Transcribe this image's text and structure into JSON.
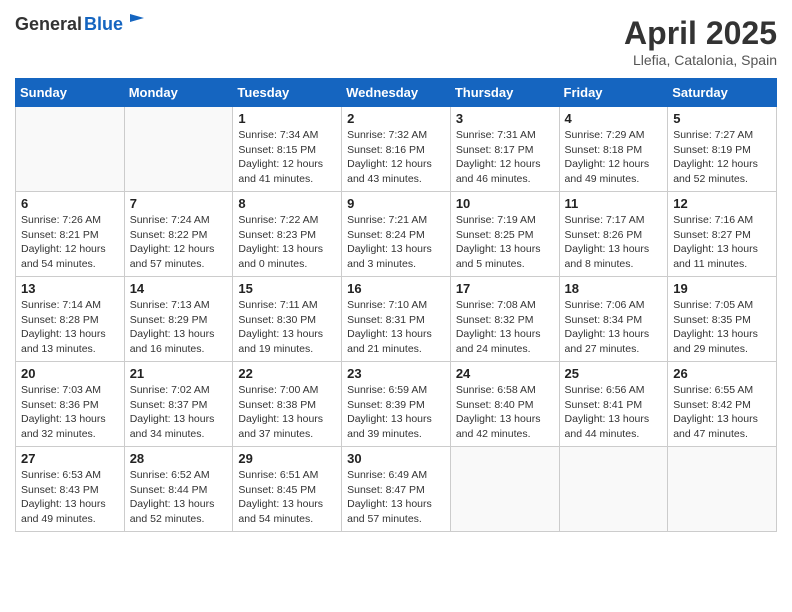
{
  "header": {
    "logo_general": "General",
    "logo_blue": "Blue",
    "month_title": "April 2025",
    "location": "Llefia, Catalonia, Spain"
  },
  "days_of_week": [
    "Sunday",
    "Monday",
    "Tuesday",
    "Wednesday",
    "Thursday",
    "Friday",
    "Saturday"
  ],
  "weeks": [
    [
      {
        "day": "",
        "sunrise": "",
        "sunset": "",
        "daylight": ""
      },
      {
        "day": "",
        "sunrise": "",
        "sunset": "",
        "daylight": ""
      },
      {
        "day": "1",
        "sunrise": "Sunrise: 7:34 AM",
        "sunset": "Sunset: 8:15 PM",
        "daylight": "Daylight: 12 hours and 41 minutes."
      },
      {
        "day": "2",
        "sunrise": "Sunrise: 7:32 AM",
        "sunset": "Sunset: 8:16 PM",
        "daylight": "Daylight: 12 hours and 43 minutes."
      },
      {
        "day": "3",
        "sunrise": "Sunrise: 7:31 AM",
        "sunset": "Sunset: 8:17 PM",
        "daylight": "Daylight: 12 hours and 46 minutes."
      },
      {
        "day": "4",
        "sunrise": "Sunrise: 7:29 AM",
        "sunset": "Sunset: 8:18 PM",
        "daylight": "Daylight: 12 hours and 49 minutes."
      },
      {
        "day": "5",
        "sunrise": "Sunrise: 7:27 AM",
        "sunset": "Sunset: 8:19 PM",
        "daylight": "Daylight: 12 hours and 52 minutes."
      }
    ],
    [
      {
        "day": "6",
        "sunrise": "Sunrise: 7:26 AM",
        "sunset": "Sunset: 8:21 PM",
        "daylight": "Daylight: 12 hours and 54 minutes."
      },
      {
        "day": "7",
        "sunrise": "Sunrise: 7:24 AM",
        "sunset": "Sunset: 8:22 PM",
        "daylight": "Daylight: 12 hours and 57 minutes."
      },
      {
        "day": "8",
        "sunrise": "Sunrise: 7:22 AM",
        "sunset": "Sunset: 8:23 PM",
        "daylight": "Daylight: 13 hours and 0 minutes."
      },
      {
        "day": "9",
        "sunrise": "Sunrise: 7:21 AM",
        "sunset": "Sunset: 8:24 PM",
        "daylight": "Daylight: 13 hours and 3 minutes."
      },
      {
        "day": "10",
        "sunrise": "Sunrise: 7:19 AM",
        "sunset": "Sunset: 8:25 PM",
        "daylight": "Daylight: 13 hours and 5 minutes."
      },
      {
        "day": "11",
        "sunrise": "Sunrise: 7:17 AM",
        "sunset": "Sunset: 8:26 PM",
        "daylight": "Daylight: 13 hours and 8 minutes."
      },
      {
        "day": "12",
        "sunrise": "Sunrise: 7:16 AM",
        "sunset": "Sunset: 8:27 PM",
        "daylight": "Daylight: 13 hours and 11 minutes."
      }
    ],
    [
      {
        "day": "13",
        "sunrise": "Sunrise: 7:14 AM",
        "sunset": "Sunset: 8:28 PM",
        "daylight": "Daylight: 13 hours and 13 minutes."
      },
      {
        "day": "14",
        "sunrise": "Sunrise: 7:13 AM",
        "sunset": "Sunset: 8:29 PM",
        "daylight": "Daylight: 13 hours and 16 minutes."
      },
      {
        "day": "15",
        "sunrise": "Sunrise: 7:11 AM",
        "sunset": "Sunset: 8:30 PM",
        "daylight": "Daylight: 13 hours and 19 minutes."
      },
      {
        "day": "16",
        "sunrise": "Sunrise: 7:10 AM",
        "sunset": "Sunset: 8:31 PM",
        "daylight": "Daylight: 13 hours and 21 minutes."
      },
      {
        "day": "17",
        "sunrise": "Sunrise: 7:08 AM",
        "sunset": "Sunset: 8:32 PM",
        "daylight": "Daylight: 13 hours and 24 minutes."
      },
      {
        "day": "18",
        "sunrise": "Sunrise: 7:06 AM",
        "sunset": "Sunset: 8:34 PM",
        "daylight": "Daylight: 13 hours and 27 minutes."
      },
      {
        "day": "19",
        "sunrise": "Sunrise: 7:05 AM",
        "sunset": "Sunset: 8:35 PM",
        "daylight": "Daylight: 13 hours and 29 minutes."
      }
    ],
    [
      {
        "day": "20",
        "sunrise": "Sunrise: 7:03 AM",
        "sunset": "Sunset: 8:36 PM",
        "daylight": "Daylight: 13 hours and 32 minutes."
      },
      {
        "day": "21",
        "sunrise": "Sunrise: 7:02 AM",
        "sunset": "Sunset: 8:37 PM",
        "daylight": "Daylight: 13 hours and 34 minutes."
      },
      {
        "day": "22",
        "sunrise": "Sunrise: 7:00 AM",
        "sunset": "Sunset: 8:38 PM",
        "daylight": "Daylight: 13 hours and 37 minutes."
      },
      {
        "day": "23",
        "sunrise": "Sunrise: 6:59 AM",
        "sunset": "Sunset: 8:39 PM",
        "daylight": "Daylight: 13 hours and 39 minutes."
      },
      {
        "day": "24",
        "sunrise": "Sunrise: 6:58 AM",
        "sunset": "Sunset: 8:40 PM",
        "daylight": "Daylight: 13 hours and 42 minutes."
      },
      {
        "day": "25",
        "sunrise": "Sunrise: 6:56 AM",
        "sunset": "Sunset: 8:41 PM",
        "daylight": "Daylight: 13 hours and 44 minutes."
      },
      {
        "day": "26",
        "sunrise": "Sunrise: 6:55 AM",
        "sunset": "Sunset: 8:42 PM",
        "daylight": "Daylight: 13 hours and 47 minutes."
      }
    ],
    [
      {
        "day": "27",
        "sunrise": "Sunrise: 6:53 AM",
        "sunset": "Sunset: 8:43 PM",
        "daylight": "Daylight: 13 hours and 49 minutes."
      },
      {
        "day": "28",
        "sunrise": "Sunrise: 6:52 AM",
        "sunset": "Sunset: 8:44 PM",
        "daylight": "Daylight: 13 hours and 52 minutes."
      },
      {
        "day": "29",
        "sunrise": "Sunrise: 6:51 AM",
        "sunset": "Sunset: 8:45 PM",
        "daylight": "Daylight: 13 hours and 54 minutes."
      },
      {
        "day": "30",
        "sunrise": "Sunrise: 6:49 AM",
        "sunset": "Sunset: 8:47 PM",
        "daylight": "Daylight: 13 hours and 57 minutes."
      },
      {
        "day": "",
        "sunrise": "",
        "sunset": "",
        "daylight": ""
      },
      {
        "day": "",
        "sunrise": "",
        "sunset": "",
        "daylight": ""
      },
      {
        "day": "",
        "sunrise": "",
        "sunset": "",
        "daylight": ""
      }
    ]
  ]
}
